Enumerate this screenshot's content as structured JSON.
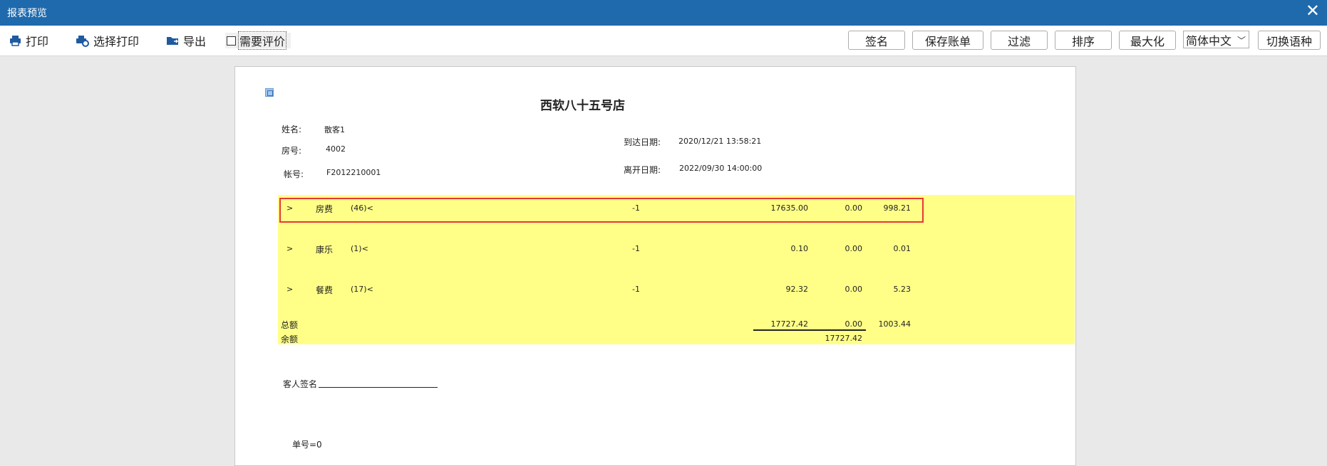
{
  "window": {
    "title": "报表预览",
    "close_glyph": "✕"
  },
  "toolbar": {
    "print": "打印",
    "select_print": "选择打印",
    "export": "导出",
    "need_review": "需要评价",
    "need_review_checked": false,
    "sign": "签名",
    "save_bill": "保存账单",
    "filter": "过滤",
    "sort": "排序",
    "maximize": "最大化",
    "language_selected": "简体中文",
    "switch_language": "切换语种"
  },
  "report": {
    "title": "西软八十五号店",
    "name_label": "姓名:",
    "name_value": "散客1",
    "room_label": "房号:",
    "room_value": "4002",
    "account_label": "帐号:",
    "account_value": "F2012210001",
    "arrival_label": "到达日期:",
    "arrival_value": "2020/12/21 13:58:21",
    "departure_label": "离开日期:",
    "departure_value": "2022/09/30 14:00:00",
    "rows": [
      {
        "arrow": ">",
        "name": "房费",
        "count": "(46)<",
        "flag": "-1",
        "amount": "17635.00",
        "col2": "0.00",
        "col3": "998.21"
      },
      {
        "arrow": ">",
        "name": "康乐",
        "count": "(1)<",
        "flag": "-1",
        "amount": "0.10",
        "col2": "0.00",
        "col3": "0.01"
      },
      {
        "arrow": ">",
        "name": "餐费",
        "count": "(17)<",
        "flag": "-1",
        "amount": "92.32",
        "col2": "0.00",
        "col3": "5.23"
      }
    ],
    "total_label": "总额",
    "total_amount": "17727.42",
    "total_col2": "0.00",
    "total_col3": "1003.44",
    "balance_label": "余额",
    "balance_value": "17727.42",
    "guest_sign_label": "客人签名",
    "bill_no": "单号=0"
  }
}
